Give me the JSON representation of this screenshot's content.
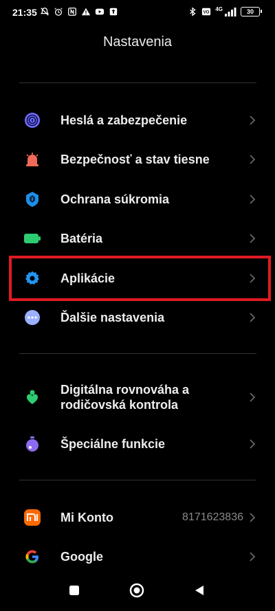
{
  "status_bar": {
    "time": "21:35",
    "network": "4G",
    "battery": "30",
    "left_icons": [
      "notifications-off-icon",
      "alarm-icon",
      "nfc-icon",
      "warning-icon",
      "youtube-icon",
      "upload-icon"
    ],
    "right_icons": [
      "bluetooth-icon",
      "volte-icon",
      "signal-icon"
    ]
  },
  "page_title": "Nastavenia",
  "groups": [
    {
      "items": [
        {
          "label": "Heslá a zabezpečenie",
          "icon": "fingerprint-icon",
          "color": "#6f6dff"
        },
        {
          "label": "Bezpečnosť a stav tiesne",
          "icon": "siren-icon",
          "color": "#f06a5a"
        },
        {
          "label": "Ochrana súkromia",
          "icon": "privacy-shield-icon",
          "color": "#1e8fe8"
        },
        {
          "label": "Batéria",
          "icon": "battery-icon",
          "color": "#2ecc71"
        },
        {
          "label": "Aplikácie",
          "icon": "gear-icon",
          "color": "#2196f3"
        },
        {
          "label": "Ďalšie nastavenia",
          "icon": "more-icon",
          "color": "#9bb0ff"
        }
      ]
    },
    {
      "items": [
        {
          "label": "Digitálna rovnováha a rodičovská kontrola",
          "label_line1": "Digitálna rovnováha a",
          "label_line2": "rodičovská kontrola",
          "icon": "wellbeing-icon",
          "color": "#2ecc71"
        },
        {
          "label": "Špeciálne funkcie",
          "icon": "special-features-icon",
          "color": "#8b6cf0"
        }
      ]
    },
    {
      "items": [
        {
          "label": "Mi Konto",
          "value": "8171623836",
          "icon": "mi-icon",
          "color": "#ff6900"
        },
        {
          "label": "Google",
          "icon": "google-icon",
          "color": "#4285f4"
        }
      ]
    }
  ],
  "highlight_color": "#e01a22",
  "nav_bar": [
    "recents-button",
    "home-button",
    "back-button"
  ]
}
